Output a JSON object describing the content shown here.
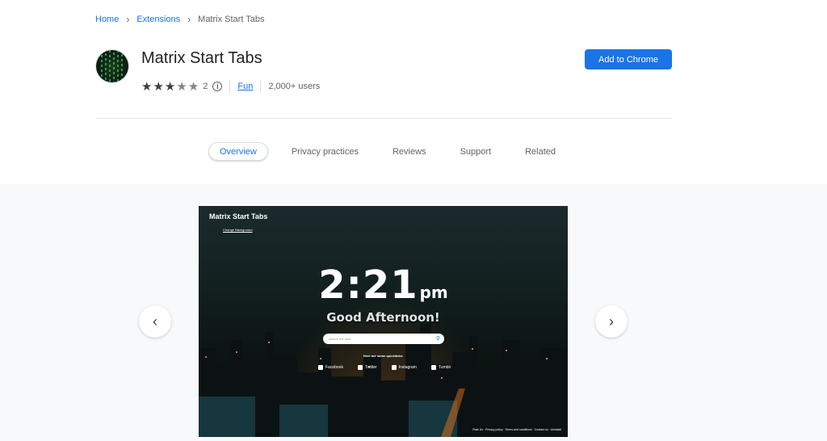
{
  "breadcrumb": {
    "home": "Home",
    "extensions": "Extensions",
    "current": "Matrix Start Tabs"
  },
  "extension": {
    "title": "Matrix Start Tabs",
    "rating_value": 3,
    "rating_max": 5,
    "rating_count": "2",
    "category": "Fun",
    "users": "2,000+ users",
    "add_button": "Add to Chrome"
  },
  "tabs": [
    {
      "label": "Overview",
      "active": true
    },
    {
      "label": "Privacy practices"
    },
    {
      "label": "Reviews"
    },
    {
      "label": "Support"
    },
    {
      "label": "Related"
    }
  ],
  "gallery": {
    "screenshot": {
      "app_title": "Matrix Start Tabs",
      "change_background": "Change Background",
      "time": "2:21",
      "ampm": "pm",
      "greeting": "Good Afternoon!",
      "search_placeholder": "search the web",
      "quicklinks_heading": "Here are some quicklinks:",
      "links": [
        "Facebook",
        "Twitter",
        "Instagram",
        "Tumblr"
      ],
      "footer": "Rate Us · Privacy policy · Terms and conditions · Contact us · Uninstall"
    }
  },
  "colors": {
    "accent": "#1a73e8",
    "text": "#202124",
    "muted": "#5f6368",
    "gallery_bg": "#f8f9fa"
  },
  "icons": {
    "prev": "chevron-left-icon",
    "next": "chevron-right-icon",
    "info": "info-icon",
    "star": "star-icon",
    "search": "search-icon"
  }
}
